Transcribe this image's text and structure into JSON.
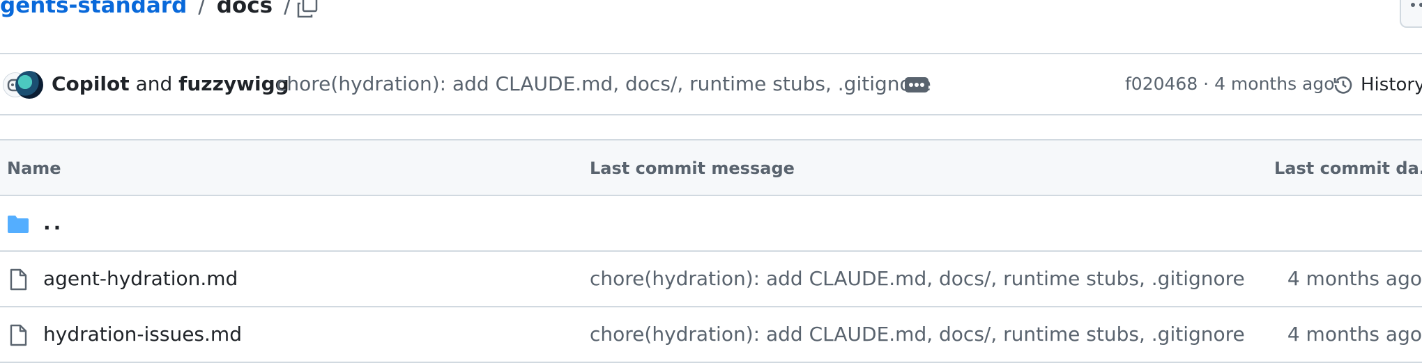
{
  "breadcrumb": {
    "repo": "gents-standard",
    "separator": "/",
    "current": "docs",
    "trailing_separator": "/"
  },
  "commit": {
    "author1": "Copilot",
    "conjunction": "and",
    "author2": "fuzzywigg",
    "message": "chore(hydration): add CLAUDE.md, docs/, runtime stubs, .gitignore",
    "hash": "f020468",
    "time": "4 months ago",
    "meta": "f020468 · 4 months ago",
    "history_label": "History"
  },
  "table": {
    "headers": {
      "name": "Name",
      "message": "Last commit message",
      "date": "Last commit da..."
    },
    "parent_label": "..",
    "rows": [
      {
        "name": "agent-hydration.md",
        "message": "chore(hydration): add CLAUDE.md, docs/, runtime stubs, .gitignore",
        "date": "4 months ago"
      },
      {
        "name": "hydration-issues.md",
        "message": "chore(hydration): add CLAUDE.md, docs/, runtime stubs, .gitignore",
        "date": "4 months ago"
      }
    ]
  },
  "icons": {
    "copy": "copy-icon",
    "more": "kebab-horizontal-icon",
    "history": "history-icon",
    "folder": "folder-icon",
    "file": "file-icon"
  },
  "colors": {
    "link": "#0969da",
    "text": "#1f2328",
    "muted": "#59636e",
    "border": "#d1d9e0",
    "header_bg": "#f6f8fa",
    "folder": "#54aeff"
  }
}
